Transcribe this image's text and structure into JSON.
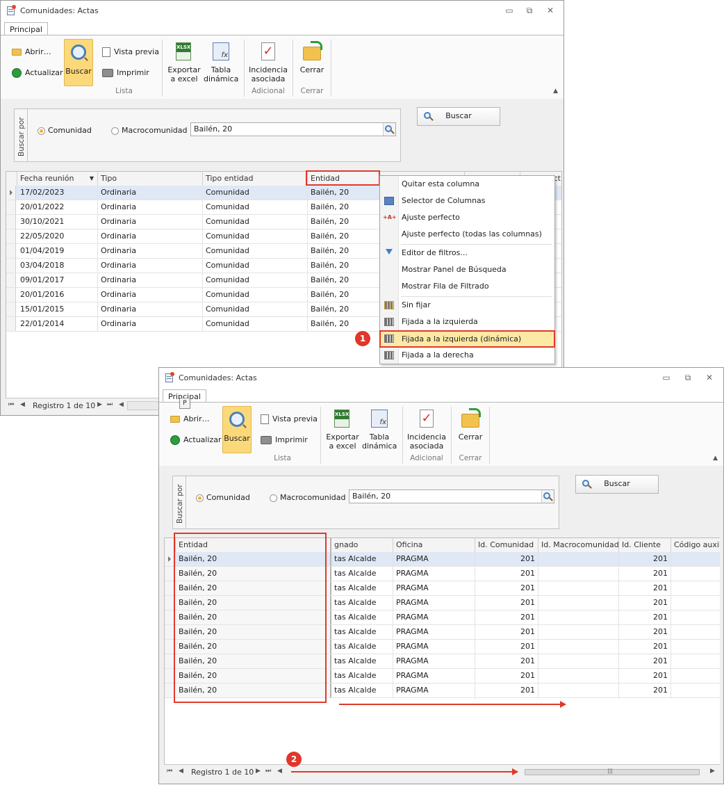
{
  "window": {
    "title": "Comunidades: Actas",
    "minimize_glyph": "▭",
    "restore_glyph": "⧉",
    "close_glyph": "✕"
  },
  "ribbon": {
    "tab": "Principal",
    "tab_key_tip": "P",
    "abrir": "Abrir…",
    "actualizar": "Actualizar",
    "buscar": "Buscar",
    "vista_previa": "Vista previa",
    "imprimir": "Imprimir",
    "exportar_l1": "Exportar",
    "exportar_l2": "a excel",
    "tabla_l1": "Tabla",
    "tabla_l2": "dinámica",
    "incidencia_l1": "Incidencia",
    "incidencia_l2": "asociada",
    "cerrar": "Cerrar",
    "group_lista": "Lista",
    "group_adicional": "Adicional",
    "group_cerrar": "Cerrar",
    "xlsx_badge": "XLSX",
    "fx_badge": "fx"
  },
  "search": {
    "vertical_label": "Buscar por",
    "radio_comunidad": "Comunidad",
    "radio_macro": "Macrocomunidad",
    "selected": "Comunidad",
    "value": "Bailén, 20",
    "button": "Buscar"
  },
  "grid1": {
    "columns": [
      "Fecha reunión",
      "Tipo",
      "Tipo entidad",
      "Entidad",
      "ct"
    ],
    "rows": [
      [
        "17/02/2023",
        "Ordinaria",
        "Comunidad",
        "Bailén, 20"
      ],
      [
        "20/01/2022",
        "Ordinaria",
        "Comunidad",
        "Bailén, 20"
      ],
      [
        "30/10/2021",
        "Ordinaria",
        "Comunidad",
        "Bailén, 20"
      ],
      [
        "22/05/2020",
        "Ordinaria",
        "Comunidad",
        "Bailén, 20"
      ],
      [
        "01/04/2019",
        "Ordinaria",
        "Comunidad",
        "Bailén, 20"
      ],
      [
        "03/04/2018",
        "Ordinaria",
        "Comunidad",
        "Bailén, 20"
      ],
      [
        "09/01/2017",
        "Ordinaria",
        "Comunidad",
        "Bailén, 20"
      ],
      [
        "20/01/2016",
        "Ordinaria",
        "Comunidad",
        "Bailén, 20"
      ],
      [
        "15/01/2015",
        "Ordinaria",
        "Comunidad",
        "Bailén, 20"
      ],
      [
        "22/01/2014",
        "Ordinaria",
        "Comunidad",
        "Bailén, 20"
      ]
    ]
  },
  "grid2": {
    "columns": [
      "Entidad",
      "gnado",
      "Oficina",
      "Id. Comunidad",
      "Id. Macrocomunidad",
      "Id. Cliente",
      "Código auxilia"
    ],
    "rows": [
      [
        "Bailén, 20",
        "tas Alcalde",
        "PRAGMA",
        "201",
        "",
        "201",
        ""
      ],
      [
        "Bailén, 20",
        "tas Alcalde",
        "PRAGMA",
        "201",
        "",
        "201",
        ""
      ],
      [
        "Bailén, 20",
        "tas Alcalde",
        "PRAGMA",
        "201",
        "",
        "201",
        ""
      ],
      [
        "Bailén, 20",
        "tas Alcalde",
        "PRAGMA",
        "201",
        "",
        "201",
        ""
      ],
      [
        "Bailén, 20",
        "tas Alcalde",
        "PRAGMA",
        "201",
        "",
        "201",
        ""
      ],
      [
        "Bailén, 20",
        "tas Alcalde",
        "PRAGMA",
        "201",
        "",
        "201",
        ""
      ],
      [
        "Bailén, 20",
        "tas Alcalde",
        "PRAGMA",
        "201",
        "",
        "201",
        ""
      ],
      [
        "Bailén, 20",
        "tas Alcalde",
        "PRAGMA",
        "201",
        "",
        "201",
        ""
      ],
      [
        "Bailén, 20",
        "tas Alcalde",
        "PRAGMA",
        "201",
        "",
        "201",
        ""
      ],
      [
        "Bailén, 20",
        "tas Alcalde",
        "PRAGMA",
        "201",
        "",
        "201",
        ""
      ]
    ]
  },
  "navigator": {
    "record_text": "Registro 1 de 10",
    "first": "⏮",
    "prev": "◀",
    "next": "▶",
    "last": "⏭",
    "scroll_left": "◀",
    "scroll_right": "▶",
    "thumb_grip": "|||"
  },
  "context_menu": {
    "items": [
      "Quitar esta columna",
      "Selector de Columnas",
      "Ajuste perfecto",
      "Ajuste perfecto (todas las columnas)",
      "Editor de filtros...",
      "Mostrar Panel de Búsqueda",
      "Mostrar Fila de Filtrado",
      "Sin fijar",
      "Fijada a la izquierda",
      "Fijada a la izquierda (dinámica)",
      "Fijada a la derecha"
    ],
    "highlighted": "Fijada a la izquierda (dinámica)",
    "ajuste_icon_text": "+A+"
  },
  "annotations": {
    "badge1": "1",
    "badge2": "2"
  },
  "colors": {
    "highlight_red": "#e0392b",
    "selected_row": "#dfe8f4",
    "buscar_active": "#fbd97a"
  }
}
